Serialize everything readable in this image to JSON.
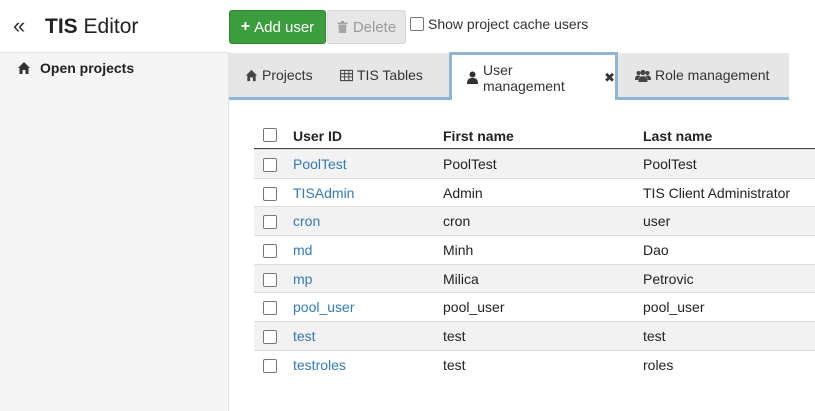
{
  "sidebar": {
    "collapse_glyph": "«",
    "brand_bold": "TIS",
    "brand_rest": " Editor",
    "items": [
      {
        "label": "Open projects",
        "icon": "home-icon"
      }
    ]
  },
  "toolbar": {
    "add_label": "Add user",
    "delete_label": "Delete",
    "cache_label": "Show project cache users"
  },
  "tabs": [
    {
      "label": "Projects",
      "icon": "home-icon"
    },
    {
      "label": "TIS Tables",
      "icon": "table-icon"
    },
    {
      "label": "User management",
      "icon": "user-icon",
      "active": true,
      "closable": true
    },
    {
      "label": "Role management",
      "icon": "users-icon"
    }
  ],
  "table": {
    "columns": [
      "User ID",
      "First name",
      "Last name"
    ],
    "rows": [
      {
        "id": "PoolTest",
        "first": "PoolTest",
        "last": "PoolTest"
      },
      {
        "id": "TISAdmin",
        "first": "Admin",
        "last": "TIS Client Administrator"
      },
      {
        "id": "cron",
        "first": "cron",
        "last": "user"
      },
      {
        "id": "md",
        "first": "Minh",
        "last": "Dao"
      },
      {
        "id": "mp",
        "first": "Milica",
        "last": "Petrovic"
      },
      {
        "id": "pool_user",
        "first": "pool_user",
        "last": "pool_user"
      },
      {
        "id": "test",
        "first": "test",
        "last": "test"
      },
      {
        "id": "testroles",
        "first": "test",
        "last": "roles"
      }
    ]
  },
  "colors": {
    "add_button": "#3c9d3f",
    "link": "#337ab7",
    "tab_accent": "#8db6d2"
  }
}
